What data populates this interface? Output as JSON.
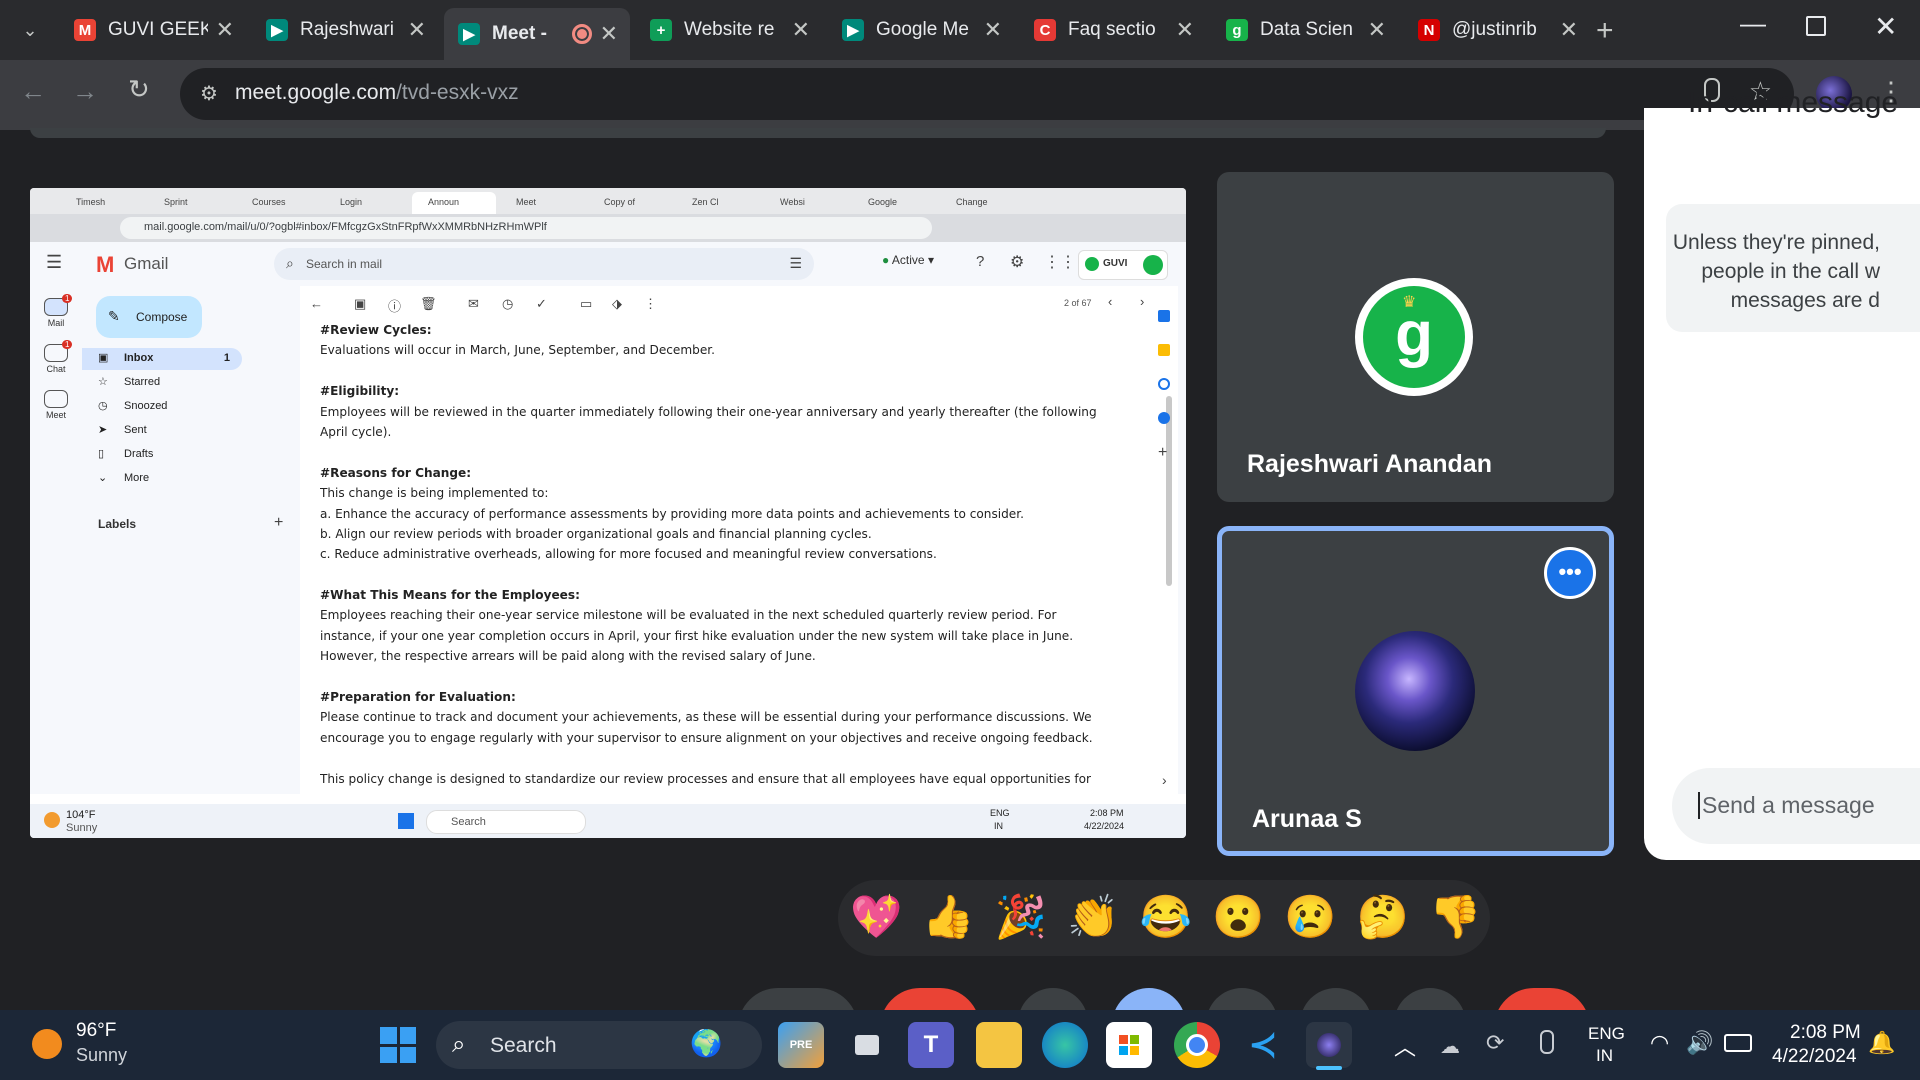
{
  "browser": {
    "tabs": [
      {
        "title": "GUVI GEEK",
        "icon": "gmail-icon",
        "color": "#ea4335",
        "glyph": "M"
      },
      {
        "title": "Rajeshwari",
        "icon": "meet-icon",
        "color": "#00897b",
        "glyph": "▶"
      },
      {
        "title": "Meet -",
        "icon": "meet-icon",
        "color": "#00897b",
        "glyph": "▶",
        "recording": true
      },
      {
        "title": "Website re",
        "icon": "sheets-icon",
        "color": "#0f9d58",
        "glyph": "+"
      },
      {
        "title": "Google Me",
        "icon": "meet-icon",
        "color": "#00897b",
        "glyph": "▶"
      },
      {
        "title": "Faq sectio",
        "icon": "calendar-icon",
        "color": "#e53935",
        "glyph": "C"
      },
      {
        "title": "Data Scien",
        "icon": "guvi-icon",
        "color": "#17b34a",
        "glyph": "g"
      },
      {
        "title": "@justinrib",
        "icon": "notion-icon",
        "color": "#d50000",
        "glyph": "N"
      }
    ],
    "url_host": "meet.google.com",
    "url_path": "/tvd-esxk-vxz"
  },
  "shared_screen": {
    "inner_tabs": [
      "Timesh",
      "Sprint",
      "Courses",
      "Login",
      "Announ",
      "Meet",
      "Copy of",
      "Zen Cl",
      "Websi",
      "Google",
      "Change"
    ],
    "inner_url": "mail.google.com/mail/u/0/?ogbl#inbox/FMfcgzGxStnFRpfWxXMMRbNHzRHmWPlf",
    "gmail": {
      "brand": "Gmail",
      "search_placeholder": "Search in mail",
      "status": "Active",
      "account": "GUVI",
      "compose": "Compose",
      "rail": [
        {
          "label": "Mail",
          "badge": "1"
        },
        {
          "label": "Chat",
          "badge": "1"
        },
        {
          "label": "Meet",
          "badge": ""
        }
      ],
      "folders": [
        {
          "label": "Inbox",
          "count": "1",
          "icon": "inbox-icon"
        },
        {
          "label": "Starred",
          "count": "",
          "icon": "star-icon"
        },
        {
          "label": "Snoozed",
          "count": "",
          "icon": "clock-icon"
        },
        {
          "label": "Sent",
          "count": "",
          "icon": "send-icon"
        },
        {
          "label": "Drafts",
          "count": "",
          "icon": "draft-icon"
        },
        {
          "label": "More",
          "count": "",
          "icon": "chevron-down-icon"
        }
      ],
      "labels_heading": "Labels",
      "pager": "2 of 67",
      "email_lines": [
        {
          "text": "#Review Cycles:",
          "bold": true
        },
        {
          "text": "Evaluations will occur in March, June, September, and December.",
          "bold": false
        },
        {
          "text": "",
          "bold": false
        },
        {
          "text": "#Eligibility:",
          "bold": true
        },
        {
          "text": "Employees will be reviewed in the quarter immediately following their one-year anniversary and yearly thereafter (the following",
          "bold": false
        },
        {
          "text": "April cycle).",
          "bold": false
        },
        {
          "text": "",
          "bold": false
        },
        {
          "text": "#Reasons for Change:",
          "bold": true
        },
        {
          "text": "This change is being implemented to:",
          "bold": false
        },
        {
          "text": "a. Enhance the accuracy of performance assessments by providing more data points and achievements to consider.",
          "bold": false
        },
        {
          "text": "b. Align our review periods with broader organizational goals and financial planning cycles.",
          "bold": false
        },
        {
          "text": "c. Reduce administrative overheads, allowing for more focused and meaningful review conversations.",
          "bold": false
        },
        {
          "text": "",
          "bold": false
        },
        {
          "text": "#What This Means for the Employees:",
          "bold": true
        },
        {
          "text": "Employees reaching their one-year service milestone will be evaluated in the next scheduled quarterly review period. For",
          "bold": false
        },
        {
          "text": "instance, if your one year completion occurs in April, your first hike evaluation under the new system will take place in June.",
          "bold": false
        },
        {
          "text": "However, the respective arrears will be paid along with the revised salary of June.",
          "bold": false
        },
        {
          "text": "",
          "bold": false
        },
        {
          "text": "#Preparation for Evaluation:",
          "bold": true
        },
        {
          "text": "Please continue to track and document your achievements, as these will be essential during your performance discussions. We",
          "bold": false
        },
        {
          "text": "encourage you to engage regularly with your supervisor to ensure alignment on your objectives and receive ongoing feedback.",
          "bold": false
        },
        {
          "text": "",
          "bold": false
        },
        {
          "text": "This policy change is designed to standardize our review processes and ensure that all employees have equal opportunities for",
          "bold": false
        }
      ],
      "inner_taskbar": {
        "temp": "104°F",
        "weather": "Sunny",
        "search": "Search",
        "lang1": "ENG",
        "lang2": "IN",
        "time": "2:08 PM",
        "date": "4/22/2024"
      }
    }
  },
  "participants": [
    {
      "name": "Rajeshwari Anandan",
      "avatar": "guvi-logo"
    },
    {
      "name": "Arunaa S",
      "avatar": "galaxy-avatar",
      "more_options": "•••"
    }
  ],
  "chat": {
    "heading_partial": "In-call message",
    "notice": "Unless they're pinned,\npeople in the call w\nmessages are d",
    "input_placeholder": "Send a message"
  },
  "reactions": [
    "💖",
    "👍",
    "🎉",
    "👏",
    "😂",
    "😮",
    "😢",
    "🤔",
    "👎"
  ],
  "taskbar": {
    "temp": "96°F",
    "weather": "Sunny",
    "search": "Search",
    "lang1": "ENG",
    "lang2": "IN",
    "time": "2:08 PM",
    "date": "4/22/2024"
  }
}
